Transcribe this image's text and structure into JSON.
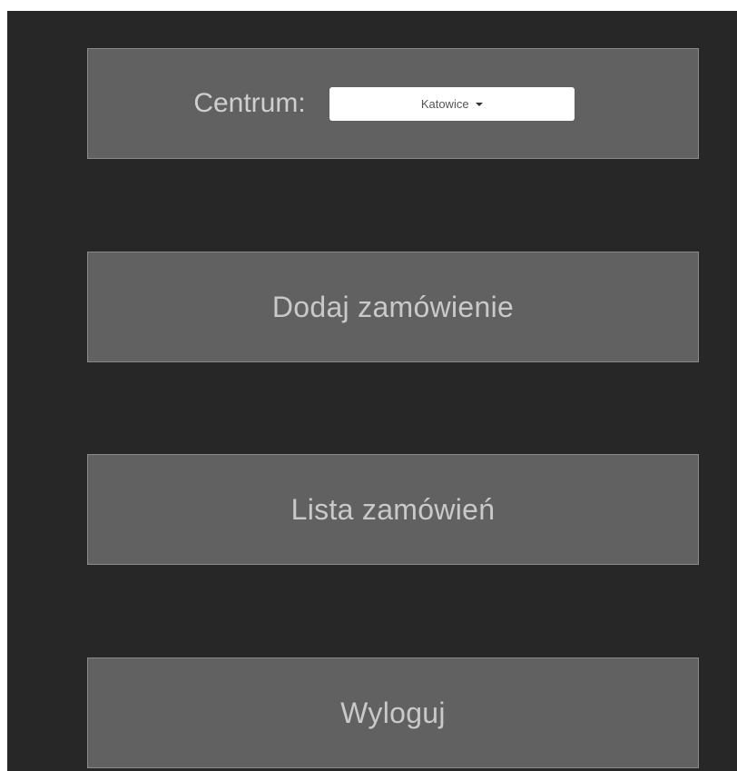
{
  "center": {
    "label": "Centrum:",
    "selected": "Katowice"
  },
  "menu": {
    "add_order": "Dodaj zamówienie",
    "order_list": "Lista zamówień",
    "logout": "Wyloguj"
  },
  "colors": {
    "background": "#272727",
    "panel": "#616161",
    "panel_border": "#8a8a8a",
    "text": "#c9c9c9",
    "select_bg": "#ffffff"
  },
  "icons": {
    "dropdown": "chevron-down-icon"
  }
}
